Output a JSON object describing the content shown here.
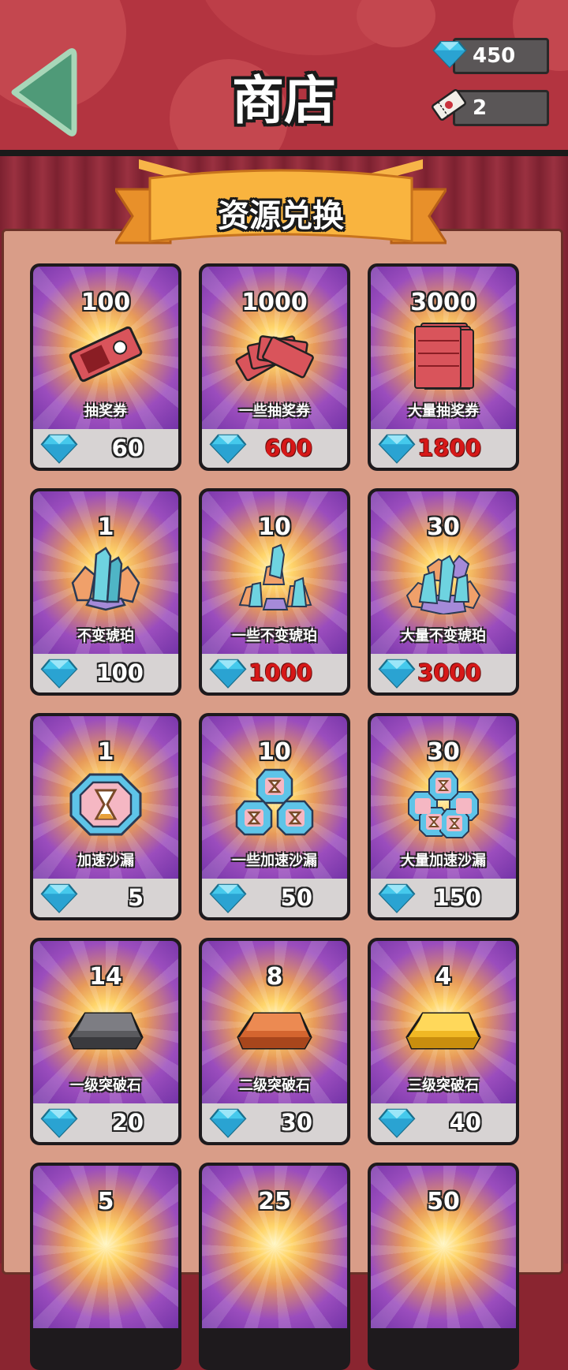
{
  "header": {
    "title": "商店",
    "currencies": [
      {
        "icon": "gem-icon",
        "value": "450"
      },
      {
        "icon": "ticket-icon",
        "value": "2"
      }
    ]
  },
  "section": {
    "title": "资源兑换"
  },
  "colors": {
    "accent_red": "#d61818",
    "header": "#b33440",
    "panel": "#d99d88",
    "gem": "#3cc6e8"
  },
  "items": [
    {
      "qty": "100",
      "name": "抽奖券",
      "price": "60",
      "price_red": false,
      "icon": "ticket-icon"
    },
    {
      "qty": "1000",
      "name": "一些抽奖券",
      "price": "600",
      "price_red": true,
      "icon": "ticket-fan-icon"
    },
    {
      "qty": "3000",
      "name": "大量抽奖券",
      "price": "1800",
      "price_red": true,
      "icon": "ticket-stack-icon"
    },
    {
      "qty": "1",
      "name": "不变琥珀",
      "price": "100",
      "price_red": false,
      "icon": "amber-crystal-icon"
    },
    {
      "qty": "10",
      "name": "一些不变琥珀",
      "price": "1000",
      "price_red": true,
      "icon": "amber-crystals-icon"
    },
    {
      "qty": "30",
      "name": "大量不变琥珀",
      "price": "3000",
      "price_red": true,
      "icon": "amber-pile-icon"
    },
    {
      "qty": "1",
      "name": "加速沙漏",
      "price": "5",
      "price_red": false,
      "icon": "hourglass-icon"
    },
    {
      "qty": "10",
      "name": "一些加速沙漏",
      "price": "50",
      "price_red": false,
      "icon": "hourglasses-icon"
    },
    {
      "qty": "30",
      "name": "大量加速沙漏",
      "price": "150",
      "price_red": false,
      "icon": "hourglass-pile-icon"
    },
    {
      "qty": "14",
      "name": "一级突破石",
      "price": "20",
      "price_red": false,
      "icon": "iron-ingot-icon"
    },
    {
      "qty": "8",
      "name": "二级突破石",
      "price": "30",
      "price_red": false,
      "icon": "copper-ingot-icon"
    },
    {
      "qty": "4",
      "name": "三级突破石",
      "price": "40",
      "price_red": false,
      "icon": "gold-ingot-icon"
    },
    {
      "qty": "5",
      "name": "",
      "price": "",
      "price_red": false,
      "icon": ""
    },
    {
      "qty": "25",
      "name": "",
      "price": "",
      "price_red": false,
      "icon": ""
    },
    {
      "qty": "50",
      "name": "",
      "price": "",
      "price_red": false,
      "icon": ""
    }
  ]
}
